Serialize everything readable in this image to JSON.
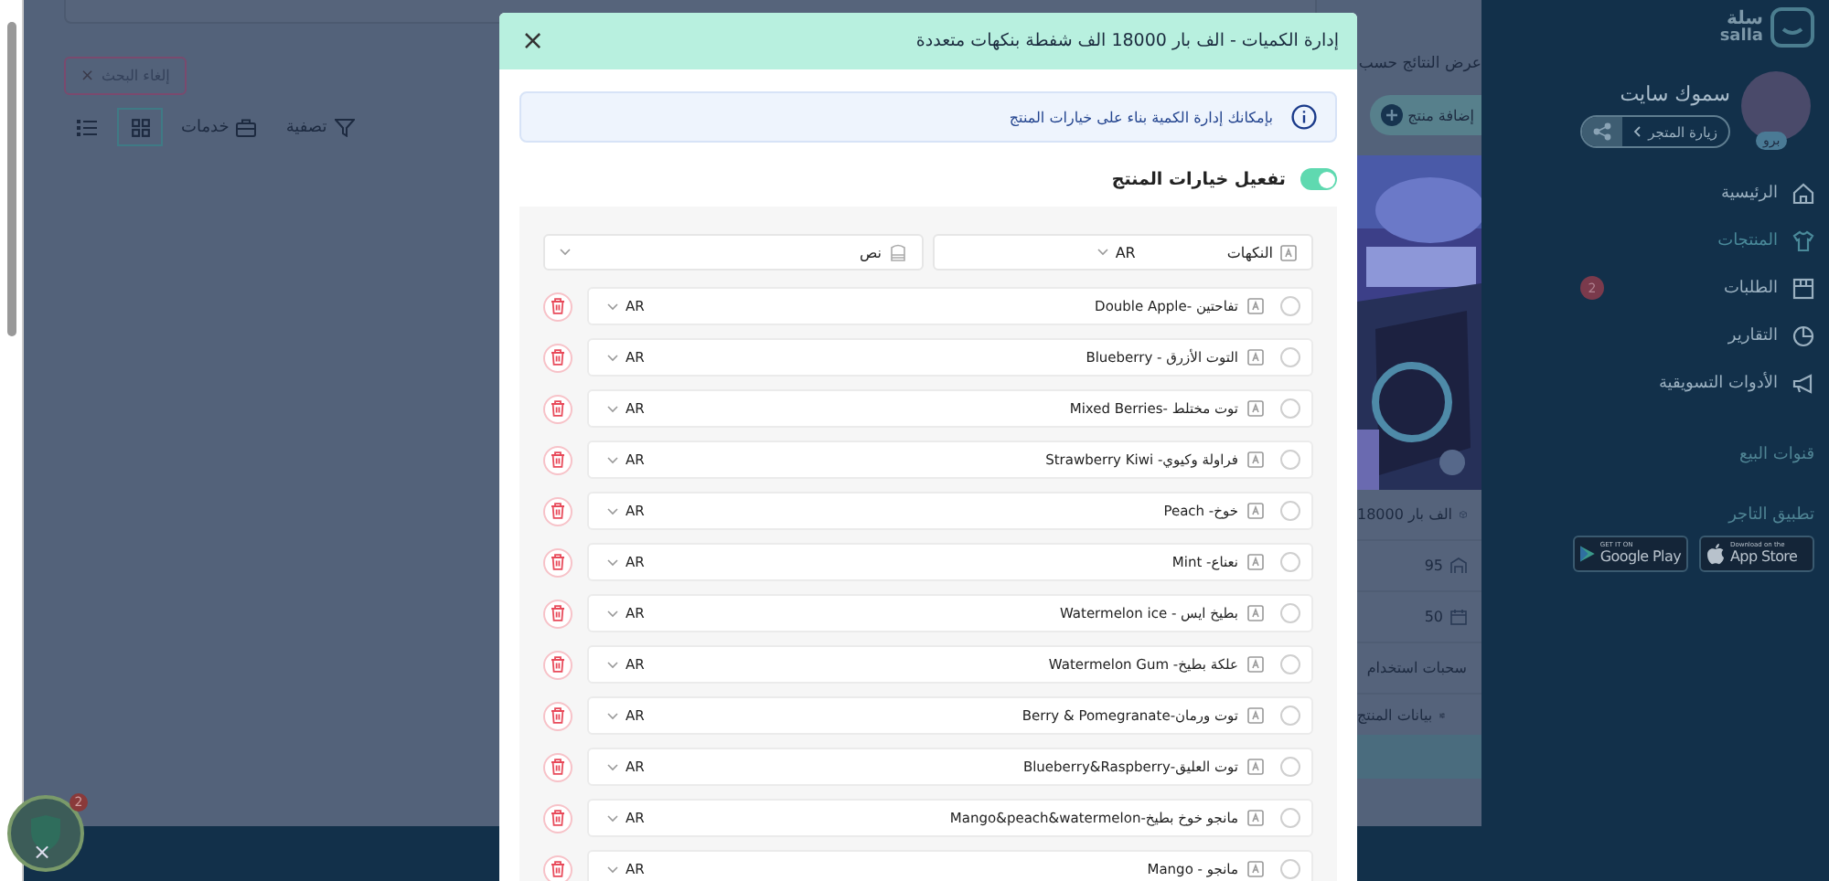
{
  "page": {
    "clear_search": "إلغاء البحث",
    "clear_icon": "×",
    "toolbar": {
      "filter": "تصفية",
      "services": "خدمات",
      "view_modes": [
        {
          "kind": "grid",
          "selected": true
        },
        {
          "kind": "list",
          "selected": false
        }
      ]
    },
    "results_label": "عرض النتائج حسب",
    "add_product": "إضافة منتج",
    "product_fields": [
      {
        "kind": "box",
        "value": "الف بار 18000"
      },
      {
        "kind": "stock",
        "value": "95"
      },
      {
        "kind": "calendar",
        "value": "50"
      },
      {
        "kind": "plain",
        "value": "سحبات استخدام"
      }
    ],
    "details": "بيانات المنتج"
  },
  "sidebar": {
    "logo_ar": "سلة",
    "logo_en": "salla",
    "store_name": "سموك سايت",
    "plan_badge": "برو",
    "visit_store": "زيارة المتجر",
    "nav": [
      {
        "kind": "home",
        "label": "الرئيسية",
        "selected": false
      },
      {
        "kind": "shirt",
        "label": "المنتجات",
        "selected": true
      },
      {
        "kind": "box",
        "label": "الطلبات",
        "selected": false,
        "badge": "2"
      },
      {
        "kind": "pie",
        "label": "التقارير",
        "selected": false
      },
      {
        "kind": "megaphone",
        "label": "الأدوات التسويقية",
        "selected": false
      }
    ],
    "sections": [
      "قنوات البيع",
      "تطبيق التاجر"
    ],
    "app_badges": [
      {
        "kind": "apple",
        "small": "Download on the",
        "label": "App Store"
      },
      {
        "kind": "google",
        "small": "GET IT ON",
        "label": "Google Play"
      }
    ]
  },
  "widget": {
    "badge": "2",
    "close": "×"
  },
  "modal": {
    "title": "إدارة الكميات - الف بار 18000 الف شفطة بنكهات متعددة",
    "close": "×",
    "info": "بإمكانك إدارة الكمية بناء على خيارات المنتج",
    "toggle": {
      "label": "تفعيل خيارات المنتج",
      "on": true
    },
    "option": {
      "name": "النكهات",
      "lang": "AR",
      "type": "نص"
    },
    "values": [
      {
        "label": "تفاحتين -Double Apple",
        "lang": "AR",
        "checked": false
      },
      {
        "label": "التوت الأزرق - Blueberry",
        "lang": "AR",
        "checked": false
      },
      {
        "label": "توت مختلط -Mixed Berries",
        "lang": "AR",
        "checked": false
      },
      {
        "label": "فراولة وكيوي- Strawberry Kiwi",
        "lang": "AR",
        "checked": false
      },
      {
        "label": "خوخ- Peach",
        "lang": "AR",
        "checked": false
      },
      {
        "label": "نعناع- Mint",
        "lang": "AR",
        "checked": false
      },
      {
        "label": "بطيخ ايس - Watermelon ice",
        "lang": "AR",
        "checked": false
      },
      {
        "label": "علكة بطيخ- Watermelon Gum",
        "lang": "AR",
        "checked": false
      },
      {
        "label": "توت ورمان-Berry & Pomegranate",
        "lang": "AR",
        "checked": false
      },
      {
        "label": "توت العليق-Blueberry&Raspberry",
        "lang": "AR",
        "checked": false
      },
      {
        "label": "مانجو خوخ بطيخ-Mango&peach&watermelon",
        "lang": "AR",
        "checked": false
      },
      {
        "label": "مانجو - Mango",
        "lang": "AR",
        "checked": false
      }
    ]
  }
}
